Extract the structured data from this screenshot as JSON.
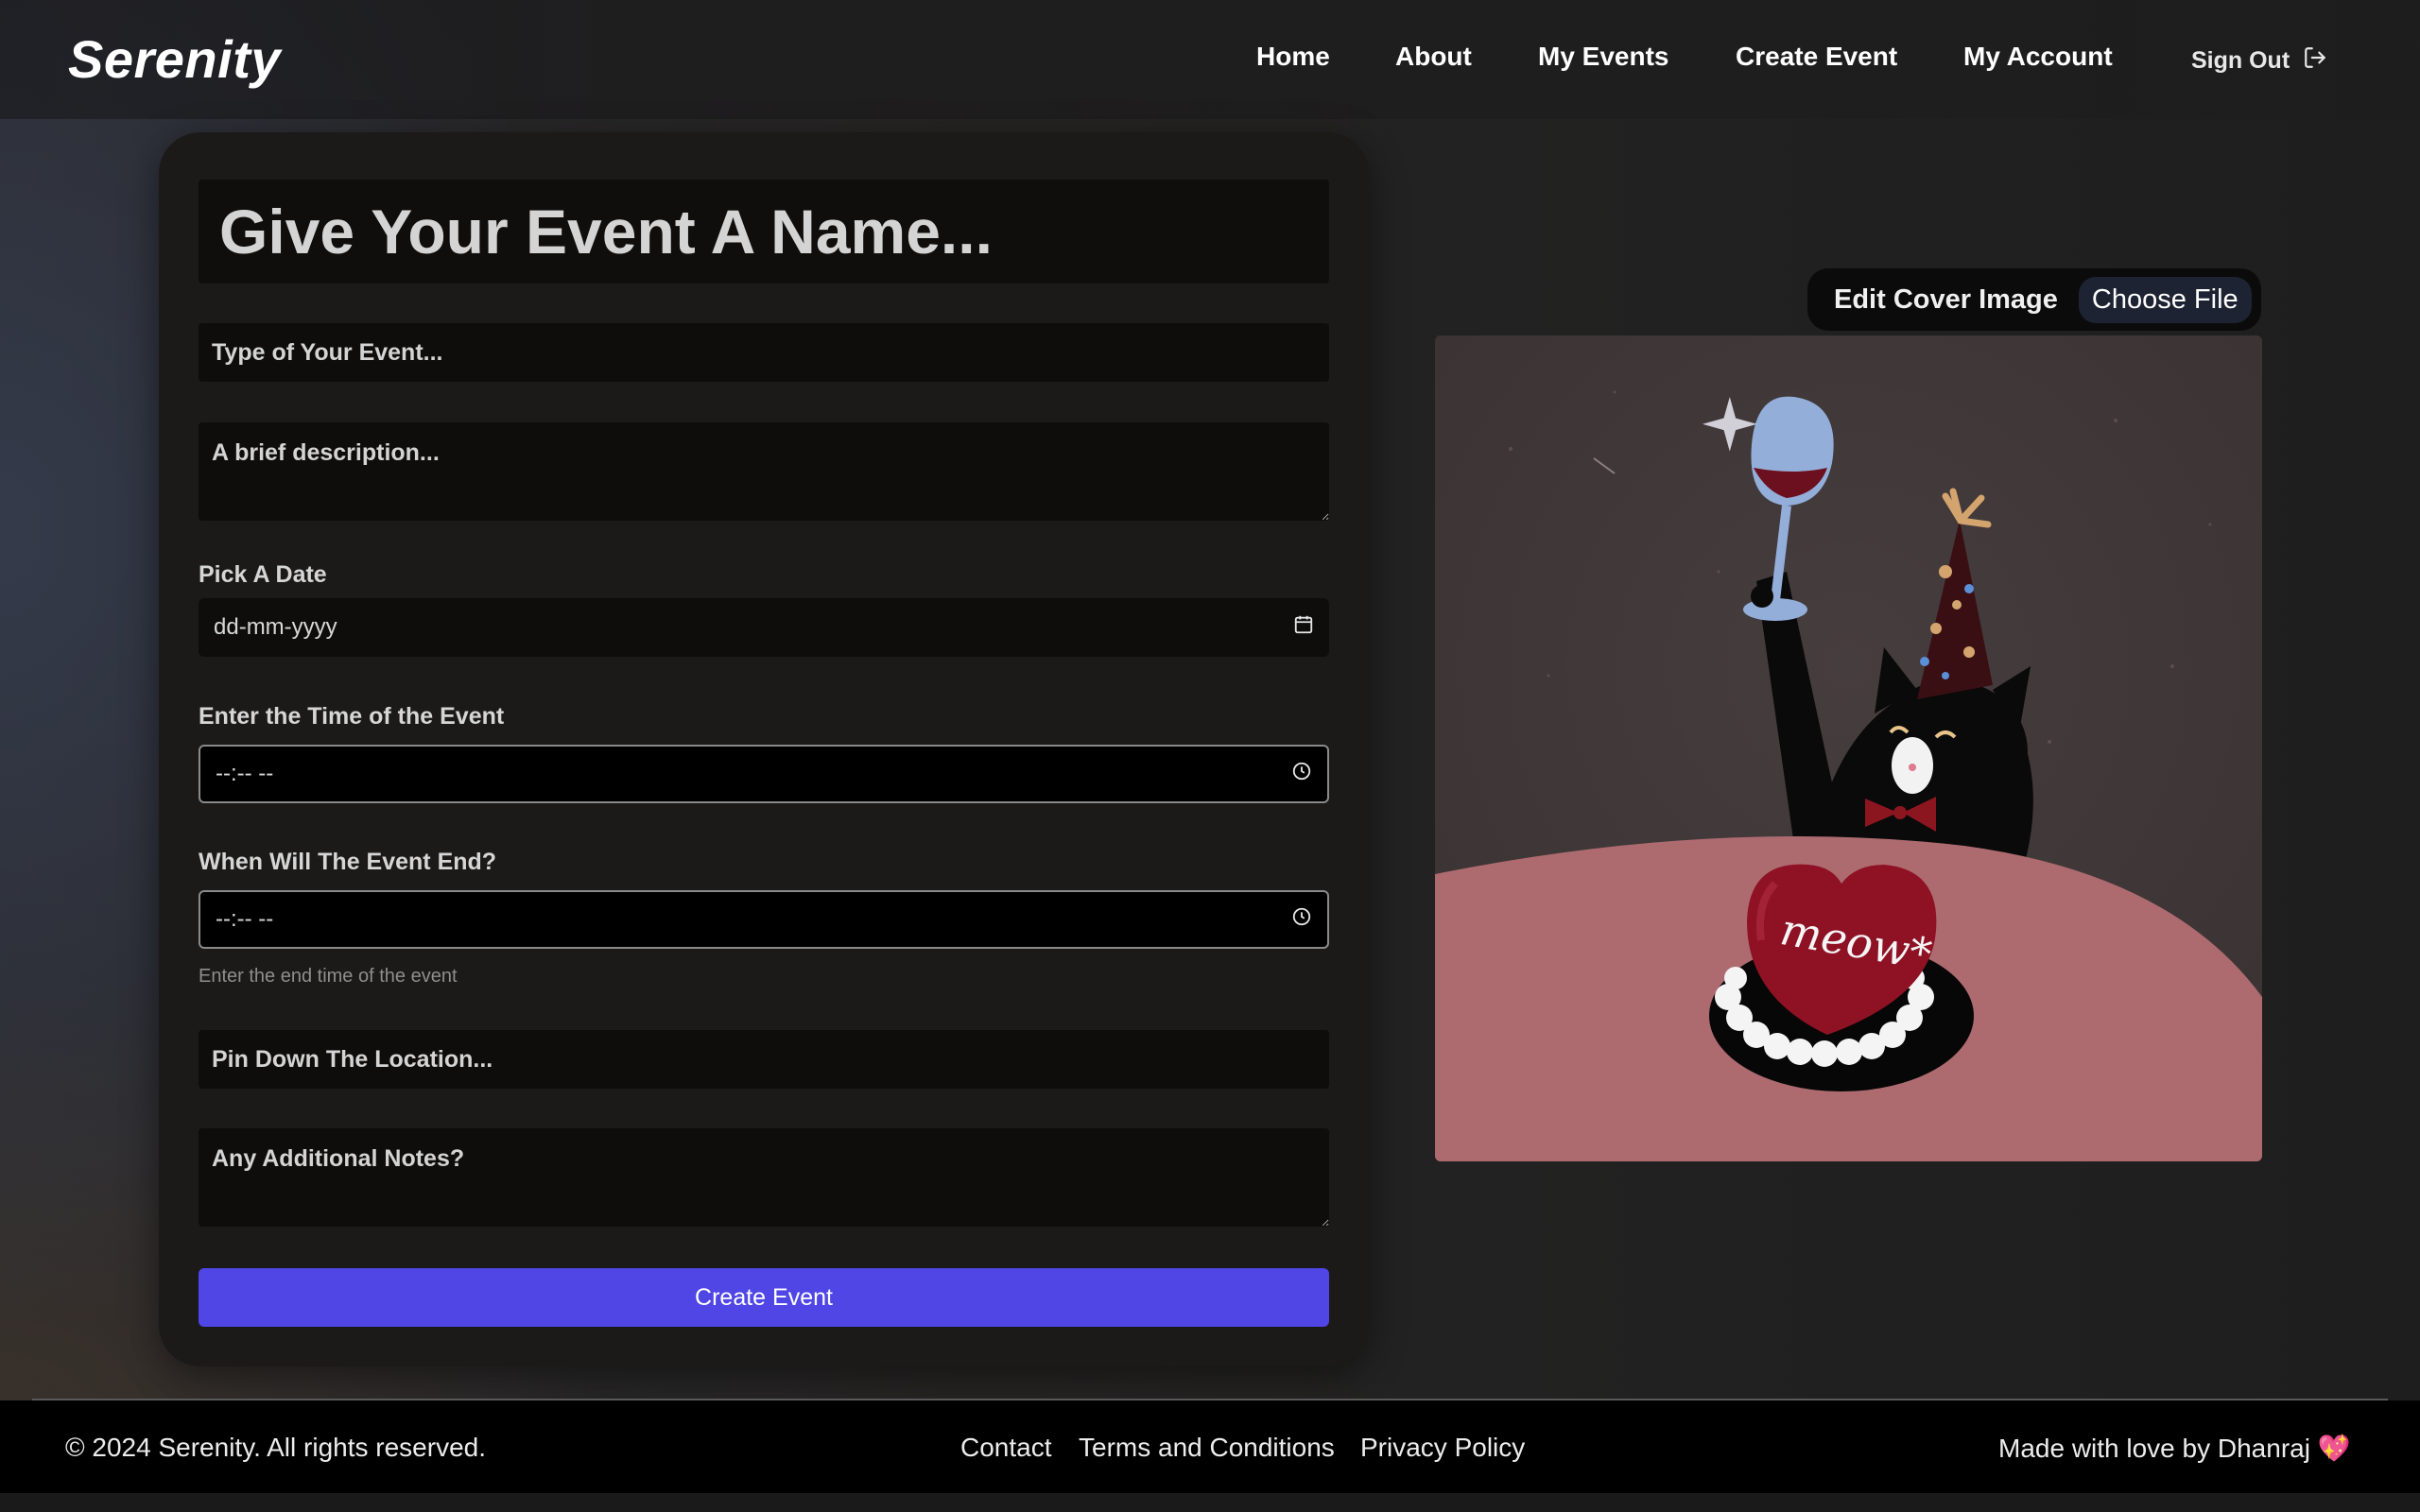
{
  "brand": "Serenity",
  "nav": {
    "links": [
      "Home",
      "About",
      "My Events",
      "Create Event",
      "My Account"
    ],
    "sign_out": "Sign Out",
    "sign_out_icon": "sign-out-icon"
  },
  "form": {
    "event_name_placeholder": "Give Your Event A Name...",
    "event_type_placeholder": "Type of Your Event...",
    "description_placeholder": "A brief description...",
    "date_label": "Pick A Date",
    "date_placeholder": "dd-mm-yyyy",
    "start_time_label": "Enter the Time of the Event",
    "start_time_placeholder": "--:-- --",
    "end_time_label": "When Will The Event End?",
    "end_time_placeholder": "--:-- --",
    "end_time_hint": "Enter the end time of the event",
    "location_placeholder": "Pin Down The Location...",
    "notes_placeholder": "Any Additional Notes?",
    "submit_label": "Create Event"
  },
  "cover": {
    "label": "Edit Cover Image",
    "choose_file": "Choose File",
    "image_text": "meow*"
  },
  "footer": {
    "copyright": "© 2024 Serenity. All rights reserved.",
    "links": [
      "Contact",
      "Terms and Conditions",
      "Privacy Policy"
    ],
    "made_by": "Made with love by Dhanraj 💖"
  },
  "colors": {
    "primary_button": "#4f46e5",
    "card_bg": "#1b1a19",
    "footer_bg": "#000000"
  }
}
